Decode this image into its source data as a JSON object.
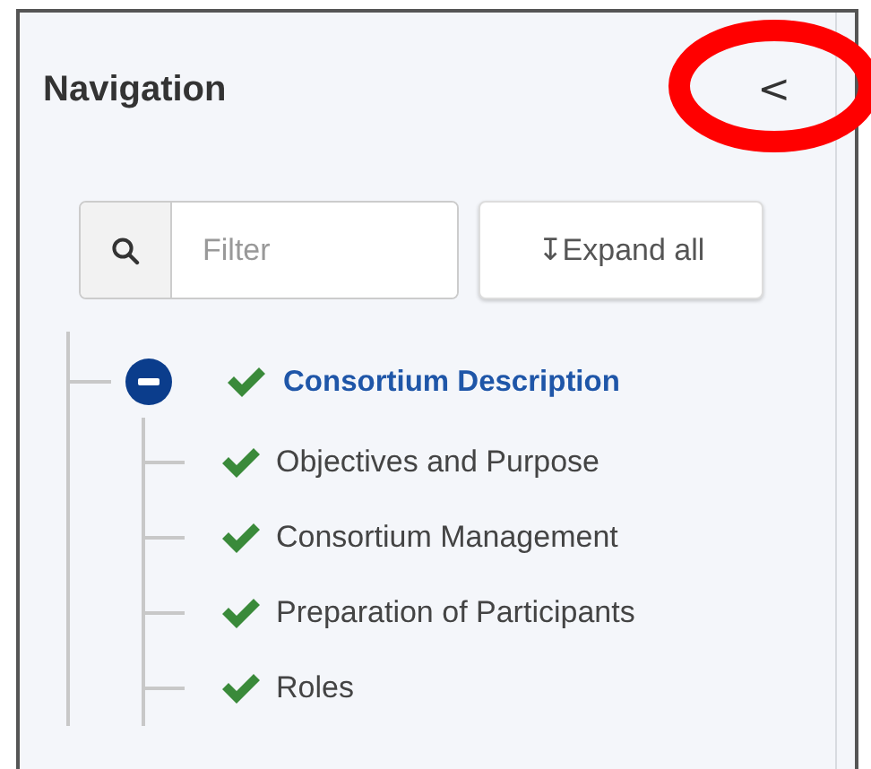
{
  "panel": {
    "title": "Navigation",
    "collapse_button": {
      "label": "<"
    }
  },
  "filter": {
    "placeholder": "Filter"
  },
  "expand_all": {
    "icon": "↧",
    "label": "Expand all"
  },
  "tree": [
    {
      "label": "Consortium Description",
      "expanded": true,
      "selected": true,
      "completed": true,
      "children": [
        {
          "label": "Objectives and Purpose",
          "selected": false,
          "completed": true
        },
        {
          "label": "Consortium Management",
          "selected": false,
          "completed": true
        },
        {
          "label": "Preparation of Participants",
          "selected": false,
          "completed": true
        },
        {
          "label": "Roles",
          "selected": false,
          "completed": true
        }
      ]
    }
  ],
  "annotation": {
    "kind": "ellipse",
    "color": "#ff0000"
  }
}
